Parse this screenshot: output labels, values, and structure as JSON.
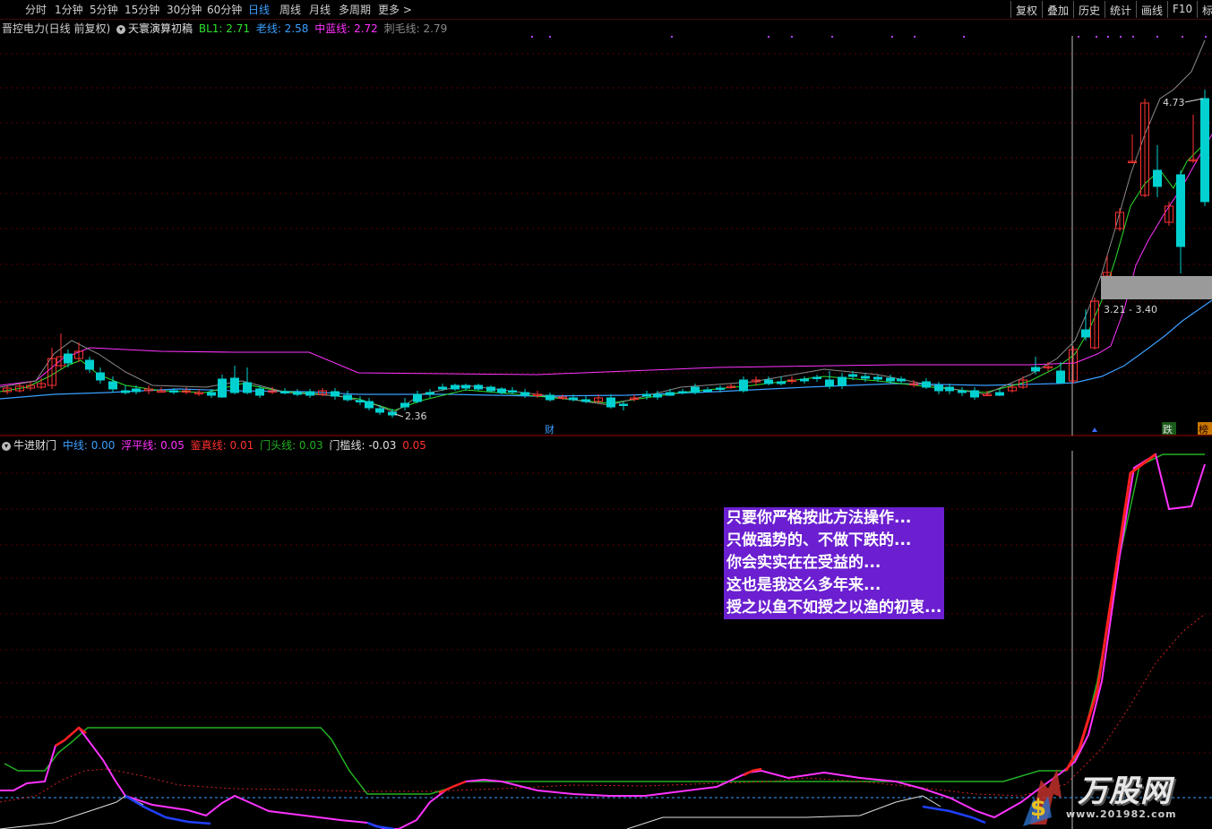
{
  "toolbar": {
    "periods": [
      "分时",
      "1分钟",
      "5分钟",
      "15分钟",
      "30分钟",
      "60分钟",
      "日线",
      "周线",
      "月线",
      "多周期",
      "更多 >"
    ],
    "active_period": "日线",
    "right_buttons": [
      "复权",
      "叠加",
      "历史",
      "统计",
      "画线",
      "F10",
      "标"
    ]
  },
  "main_legend": {
    "title": "晋控电力(日线 前复权)",
    "indicator": "天寰演算初稿",
    "items": [
      {
        "label": "BL1: 2.71",
        "color": "#2ee02e"
      },
      {
        "label": "老线: 2.58",
        "color": "#3a9fff"
      },
      {
        "label": "中蓝线: 2.72",
        "color": "#ff33ff"
      },
      {
        "label": "刺毛线: 2.79",
        "color": "#8a8a8a"
      }
    ]
  },
  "main_chart": {
    "price_labels": {
      "low": "2.36",
      "high": "4.73",
      "range": "3.21 - 3.40"
    },
    "markers": {
      "cai": "财",
      "die": "跌",
      "bang": "榜"
    }
  },
  "sub_legend": {
    "indicator": "牛进财门",
    "items": [
      {
        "label": "中线: 0.00",
        "color": "#3a9fff"
      },
      {
        "label": "浮平线: 0.05",
        "color": "#ff33ff"
      },
      {
        "label": "鉴真线: 0.01",
        "color": "#ff3030"
      },
      {
        "label": "门头线: 0.03",
        "color": "#22b022"
      },
      {
        "label": "门槛线: -0.03",
        "color": "#e0e0e0"
      },
      {
        "label": "0.05",
        "color": "#ff3030"
      }
    ]
  },
  "overlay_text": [
    "只要你严格按此方法操作...",
    "只做强势的、不做下跌的...",
    "你会实实在在受益的...",
    "这也是我这么多年来...",
    "授之以鱼不如授之以渔的初衷..."
  ],
  "watermark": {
    "text": "万股网",
    "url": "www.201982.com"
  },
  "colors": {
    "up": "#ff3232",
    "down": "#00d0d0",
    "grid": "#5a0000"
  }
}
